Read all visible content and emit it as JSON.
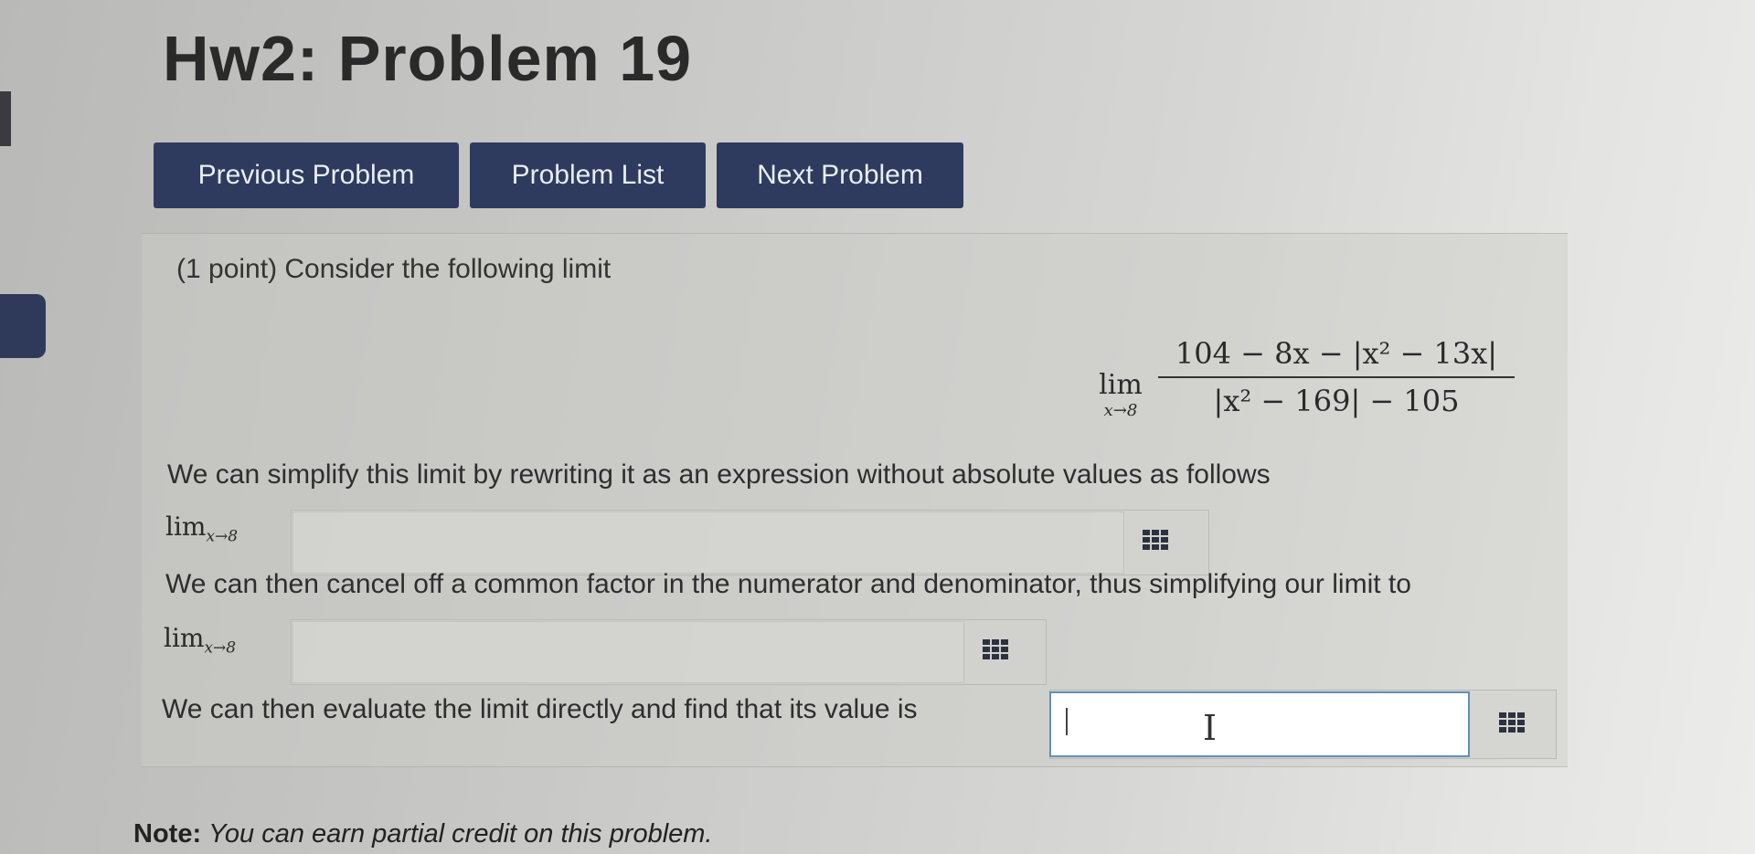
{
  "page": {
    "title": "Hw2: Problem 19"
  },
  "nav": {
    "previous_label": "Previous Problem",
    "list_label": "Problem List",
    "next_label": "Next Problem"
  },
  "problem": {
    "intro": "(1 point) Consider the following limit",
    "limit": {
      "lim_word": "lim",
      "subscript": "x→8",
      "numerator": "104 − 8x − |x² − 13x|",
      "denominator": "|x² − 169| − 105"
    },
    "step1_text": "We can simplify this limit by rewriting it as an expression without absolute values as follows",
    "step1_lim": "lim",
    "step1_sub": "x→8",
    "step1_value": "",
    "step2_text": "We can then cancel off a common factor in the numerator and denominator, thus simplifying our limit to",
    "step2_lim": "lim",
    "step2_sub": "x→8",
    "step2_value": "",
    "step3_text": "We can then evaluate the limit directly and find that its value is",
    "step3_value": ""
  },
  "note": {
    "label": "Note:",
    "text": "You can earn partial credit on this problem."
  },
  "colors": {
    "nav_button": "#2e3b5e",
    "active_input_border": "#5f8fb9"
  }
}
